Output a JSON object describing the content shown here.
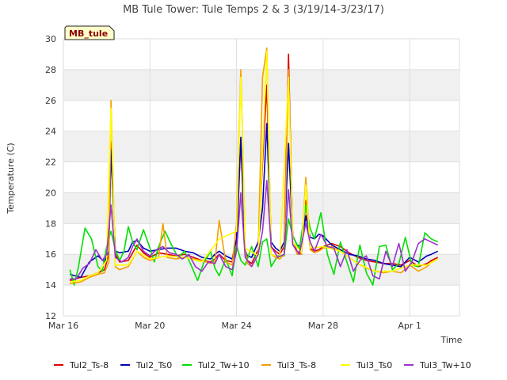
{
  "chart_data": {
    "type": "line",
    "title": "MB Tule Tower: Tule Temps 2 & 3 (3/19/14-3/23/17)",
    "badge": "MB_tule",
    "xlabel": "Time",
    "ylabel": "Temperature (C)",
    "xlim": [
      0,
      18.3
    ],
    "ylim": [
      12,
      30
    ],
    "yticks": [
      12,
      14,
      16,
      18,
      20,
      22,
      24,
      26,
      28,
      30
    ],
    "xticks": [
      {
        "value": 0,
        "label": "Mar 16"
      },
      {
        "value": 4,
        "label": "Mar 20"
      },
      {
        "value": 8,
        "label": "Mar 24"
      },
      {
        "value": 12,
        "label": "Mar 28"
      },
      {
        "value": 16,
        "label": "Apr 1"
      }
    ],
    "grid": true,
    "legend_position": "bottom",
    "series": [
      {
        "name": "Tul2_Ts-8",
        "color": "#dd0000",
        "x": [
          0.3,
          0.8,
          1.2,
          1.6,
          1.9,
          2.1,
          2.2,
          2.4,
          2.6,
          3.0,
          3.2,
          3.4,
          3.7,
          4.0,
          4.4,
          4.8,
          5.2,
          5.6,
          6.0,
          6.4,
          6.8,
          7.0,
          7.2,
          7.5,
          7.8,
          8.0,
          8.2,
          8.4,
          8.5,
          8.7,
          9.0,
          9.2,
          9.4,
          9.6,
          9.8,
          10.0,
          10.2,
          10.4,
          10.6,
          10.8,
          11.0,
          11.2,
          11.4,
          11.6,
          11.8,
          12.0,
          12.4,
          12.8,
          13.2,
          13.6,
          14.0,
          14.4,
          14.8,
          15.2,
          15.6,
          16.0,
          16.4,
          16.8,
          17.0,
          17.3
        ],
        "y": [
          14.3,
          14.5,
          14.6,
          14.8,
          15.0,
          16.0,
          23.3,
          16.0,
          15.5,
          15.6,
          16.1,
          16.6,
          16.1,
          15.8,
          16.1,
          16.0,
          15.9,
          16.0,
          15.8,
          15.6,
          15.5,
          15.7,
          16.0,
          15.6,
          15.5,
          16.5,
          23.5,
          16.0,
          15.6,
          15.4,
          16.3,
          22.0,
          27.0,
          16.5,
          16.2,
          16.0,
          16.5,
          29.0,
          16.8,
          16.2,
          16.0,
          19.5,
          16.4,
          16.2,
          16.3,
          16.5,
          16.7,
          16.5,
          16.1,
          15.8,
          15.6,
          15.5,
          15.4,
          15.4,
          15.3,
          15.6,
          15.2,
          15.4,
          15.6,
          15.8
        ]
      },
      {
        "name": "Tul2_Ts0",
        "color": "#0000bb",
        "x": [
          0.3,
          0.8,
          1.2,
          1.6,
          1.9,
          2.1,
          2.2,
          2.4,
          2.6,
          3.0,
          3.2,
          3.4,
          3.7,
          4.0,
          4.4,
          4.8,
          5.2,
          5.6,
          6.0,
          6.4,
          6.8,
          7.0,
          7.2,
          7.5,
          7.8,
          8.0,
          8.2,
          8.4,
          8.5,
          8.7,
          9.0,
          9.2,
          9.4,
          9.6,
          9.8,
          10.0,
          10.2,
          10.4,
          10.6,
          10.8,
          11.0,
          11.2,
          11.4,
          11.6,
          11.8,
          12.0,
          12.4,
          12.8,
          13.2,
          13.6,
          14.0,
          14.4,
          14.8,
          15.2,
          15.6,
          16.0,
          16.4,
          16.8,
          17.0,
          17.3
        ],
        "y": [
          14.7,
          14.5,
          15.5,
          15.9,
          15.5,
          16.2,
          22.8,
          16.2,
          16.1,
          16.2,
          16.8,
          16.9,
          16.4,
          16.2,
          16.3,
          16.4,
          16.4,
          16.2,
          16.1,
          15.8,
          15.7,
          16.0,
          16.2,
          15.9,
          15.7,
          17.0,
          23.6,
          16.3,
          15.9,
          15.8,
          16.8,
          19.0,
          24.5,
          16.8,
          16.4,
          16.2,
          16.8,
          23.2,
          17.2,
          16.6,
          16.5,
          18.5,
          17.1,
          17.0,
          17.3,
          17.2,
          16.6,
          16.3,
          16.0,
          15.9,
          15.7,
          15.6,
          15.4,
          15.3,
          15.2,
          15.8,
          15.5,
          15.9,
          16.0,
          16.2
        ]
      },
      {
        "name": "Tul2_Tw+10",
        "color": "#00e000",
        "x": [
          0.3,
          0.5,
          0.7,
          1.0,
          1.3,
          1.6,
          1.8,
          2.0,
          2.2,
          2.4,
          2.6,
          2.8,
          3.0,
          3.2,
          3.4,
          3.7,
          4.0,
          4.2,
          4.4,
          4.7,
          5.0,
          5.3,
          5.6,
          5.9,
          6.2,
          6.5,
          6.8,
          7.0,
          7.2,
          7.5,
          7.8,
          8.0,
          8.2,
          8.4,
          8.7,
          9.0,
          9.2,
          9.4,
          9.6,
          9.9,
          10.2,
          10.4,
          10.6,
          10.9,
          11.2,
          11.4,
          11.6,
          11.9,
          12.2,
          12.5,
          12.8,
          13.1,
          13.4,
          13.7,
          14.0,
          14.3,
          14.6,
          14.9,
          15.2,
          15.5,
          15.8,
          16.1,
          16.4,
          16.7,
          17.0,
          17.3
        ],
        "y": [
          15.0,
          14.0,
          15.2,
          17.7,
          17.0,
          15.2,
          14.9,
          16.5,
          17.5,
          16.3,
          15.6,
          16.2,
          17.8,
          16.8,
          16.3,
          17.6,
          16.4,
          15.5,
          16.5,
          17.5,
          16.6,
          15.8,
          16.2,
          15.3,
          14.3,
          15.5,
          16.2,
          15.1,
          14.6,
          15.7,
          14.6,
          16.6,
          15.6,
          15.3,
          16.5,
          15.2,
          16.8,
          17.0,
          15.2,
          15.9,
          15.9,
          18.3,
          17.2,
          16.3,
          19.2,
          17.7,
          17.0,
          18.7,
          16.0,
          14.7,
          16.8,
          15.5,
          14.2,
          16.6,
          14.8,
          14.0,
          16.5,
          16.6,
          15.0,
          15.4,
          17.1,
          15.3,
          15.2,
          17.4,
          17.0,
          16.8
        ]
      },
      {
        "name": "Tul3_Ts-8",
        "color": "#f5a000",
        "x": [
          0.3,
          0.8,
          1.2,
          1.6,
          1.9,
          2.1,
          2.2,
          2.4,
          2.6,
          3.0,
          3.2,
          3.4,
          3.7,
          4.0,
          4.4,
          4.6,
          4.8,
          5.2,
          5.6,
          6.0,
          6.4,
          6.8,
          7.0,
          7.2,
          7.5,
          7.8,
          8.0,
          8.2,
          8.4,
          8.5,
          8.7,
          9.0,
          9.2,
          9.4,
          9.6,
          9.8,
          10.0,
          10.2,
          10.4,
          10.6,
          10.8,
          11.0,
          11.2,
          11.4,
          11.6,
          11.8,
          12.0,
          12.4,
          12.8,
          13.2,
          13.6,
          14.0,
          14.4,
          14.8,
          15.2,
          15.6,
          16.0,
          16.4,
          16.8,
          17.0,
          17.3
        ],
        "y": [
          14.1,
          14.2,
          14.5,
          14.7,
          14.8,
          15.5,
          26.0,
          15.2,
          15.0,
          15.2,
          15.7,
          16.2,
          15.8,
          15.6,
          15.8,
          18.0,
          15.8,
          15.7,
          15.8,
          15.7,
          15.6,
          15.4,
          15.5,
          18.2,
          15.5,
          15.3,
          18.0,
          28.0,
          16.5,
          15.4,
          15.2,
          16.0,
          27.5,
          29.4,
          16.0,
          15.8,
          15.7,
          16.0,
          28.0,
          16.8,
          16.0,
          16.0,
          21.0,
          16.3,
          16.1,
          16.2,
          16.4,
          16.5,
          16.2,
          15.8,
          15.4,
          15.1,
          14.9,
          14.8,
          14.9,
          14.8,
          15.3,
          14.9,
          15.2,
          15.5,
          15.7
        ]
      },
      {
        "name": "Tul3_Ts0",
        "color": "#ffff00",
        "x": [
          0.3,
          0.8,
          1.2,
          1.6,
          2.0,
          2.2,
          2.4,
          3.0,
          3.4,
          4.0,
          4.8,
          5.6,
          6.4,
          7.2,
          8.0,
          8.2,
          8.4,
          9.0,
          9.4,
          9.6,
          10.0,
          10.4,
          10.6,
          11.0,
          11.2,
          11.4,
          12.0,
          12.8,
          13.6,
          14.4,
          15.2,
          16.0,
          16.8,
          17.3
        ],
        "y": [
          14.2,
          14.3,
          14.6,
          14.8,
          15.6,
          25.5,
          15.3,
          15.3,
          16.2,
          15.7,
          15.9,
          15.8,
          15.5,
          17.0,
          17.5,
          27.5,
          16.4,
          15.9,
          29.2,
          16.0,
          15.8,
          27.5,
          16.8,
          16.1,
          20.5,
          16.4,
          16.5,
          16.2,
          15.4,
          14.9,
          14.9,
          15.3,
          15.3,
          15.7
        ]
      },
      {
        "name": "Tul3_Tw+10",
        "color": "#9933cc",
        "x": [
          0.3,
          0.6,
          0.9,
          1.2,
          1.5,
          1.8,
          2.0,
          2.2,
          2.4,
          2.7,
          3.0,
          3.2,
          3.4,
          3.7,
          4.0,
          4.3,
          4.6,
          4.9,
          5.2,
          5.5,
          5.8,
          6.1,
          6.4,
          6.7,
          7.0,
          7.2,
          7.5,
          7.8,
          8.0,
          8.2,
          8.4,
          8.7,
          9.0,
          9.2,
          9.4,
          9.6,
          9.9,
          10.2,
          10.4,
          10.6,
          10.9,
          11.2,
          11.4,
          11.6,
          11.9,
          12.2,
          12.5,
          12.8,
          13.1,
          13.4,
          13.7,
          14.0,
          14.3,
          14.6,
          14.9,
          15.2,
          15.5,
          15.8,
          16.1,
          16.4,
          16.7,
          17.0,
          17.3
        ],
        "y": [
          14.4,
          14.4,
          15.1,
          15.4,
          16.3,
          15.6,
          16.0,
          19.2,
          15.8,
          15.5,
          15.8,
          16.5,
          17.0,
          16.2,
          15.9,
          16.3,
          16.5,
          16.1,
          16.0,
          15.7,
          16.0,
          15.2,
          14.9,
          15.5,
          15.4,
          16.0,
          15.2,
          15.0,
          16.2,
          20.0,
          15.8,
          15.2,
          16.0,
          17.5,
          20.8,
          16.5,
          15.8,
          16.0,
          20.2,
          16.6,
          16.0,
          18.0,
          16.8,
          16.2,
          17.3,
          16.5,
          16.4,
          15.2,
          16.3,
          14.9,
          15.6,
          15.9,
          14.6,
          14.4,
          16.2,
          15.2,
          16.7,
          14.9,
          15.5,
          16.7,
          17.0,
          16.8,
          16.6
        ]
      }
    ]
  }
}
